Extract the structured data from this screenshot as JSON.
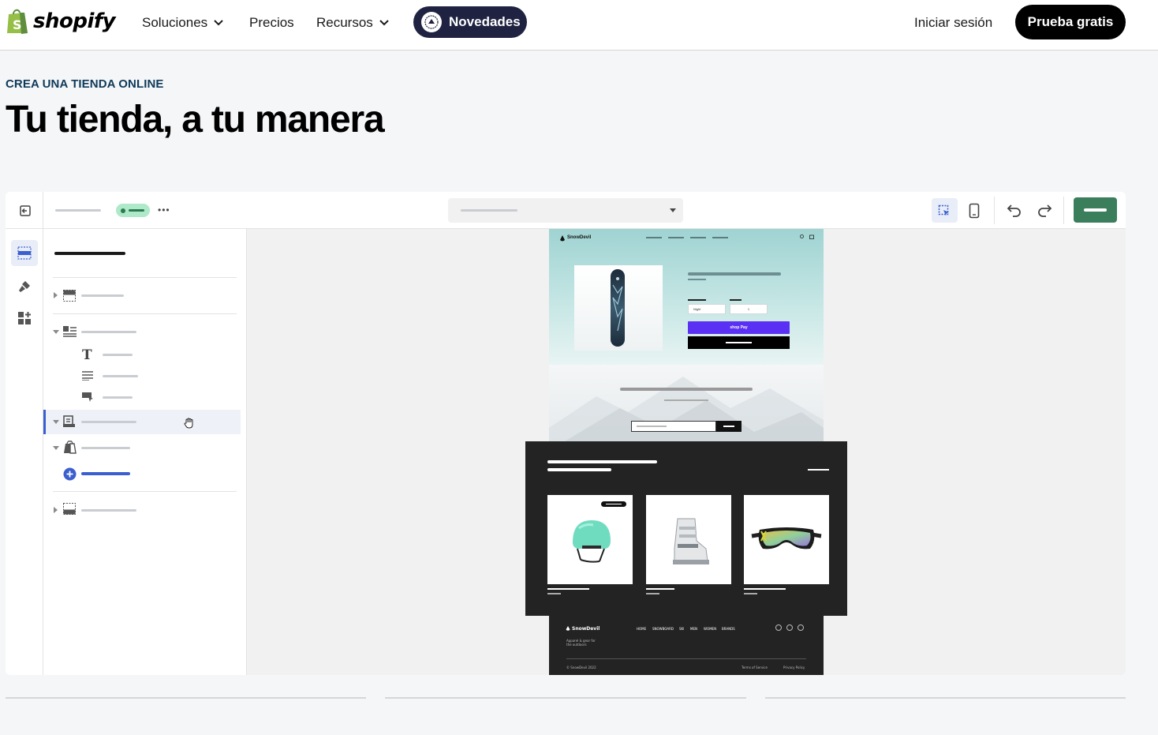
{
  "nav": {
    "brand": "shopify",
    "items": [
      {
        "label": "Soluciones",
        "has_dropdown": true
      },
      {
        "label": "Precios",
        "has_dropdown": false
      },
      {
        "label": "Recursos",
        "has_dropdown": true
      }
    ],
    "news_label": "Novedades",
    "signin_label": "Iniciar sesión",
    "cta_label": "Prueba gratis"
  },
  "hero": {
    "kicker": "CREA UNA TIENDA ONLINE",
    "title": "Tu tienda, a tu manera"
  },
  "preview": {
    "store_name": "SnowDevil",
    "variant_label": "Night",
    "quantity": "1",
    "shop_pay_label": "shop Pay",
    "footer_menu": [
      "HOME",
      "SNOWBOARD",
      "SKI",
      "MEN",
      "WOMEN",
      "BRANDS"
    ],
    "footer_tagline": "Apparel & gear for the outdoors",
    "copyright": "© SnowDevil 2022",
    "terms": "Terms of Service",
    "privacy": "Privacy Policy"
  },
  "colors": {
    "brand_green": "#95bf47",
    "publish_green": "#3b7e5b",
    "news_pill": "#1f2341",
    "accent_blue": "#3b5fcf",
    "shop_pay": "#5a31f4"
  }
}
